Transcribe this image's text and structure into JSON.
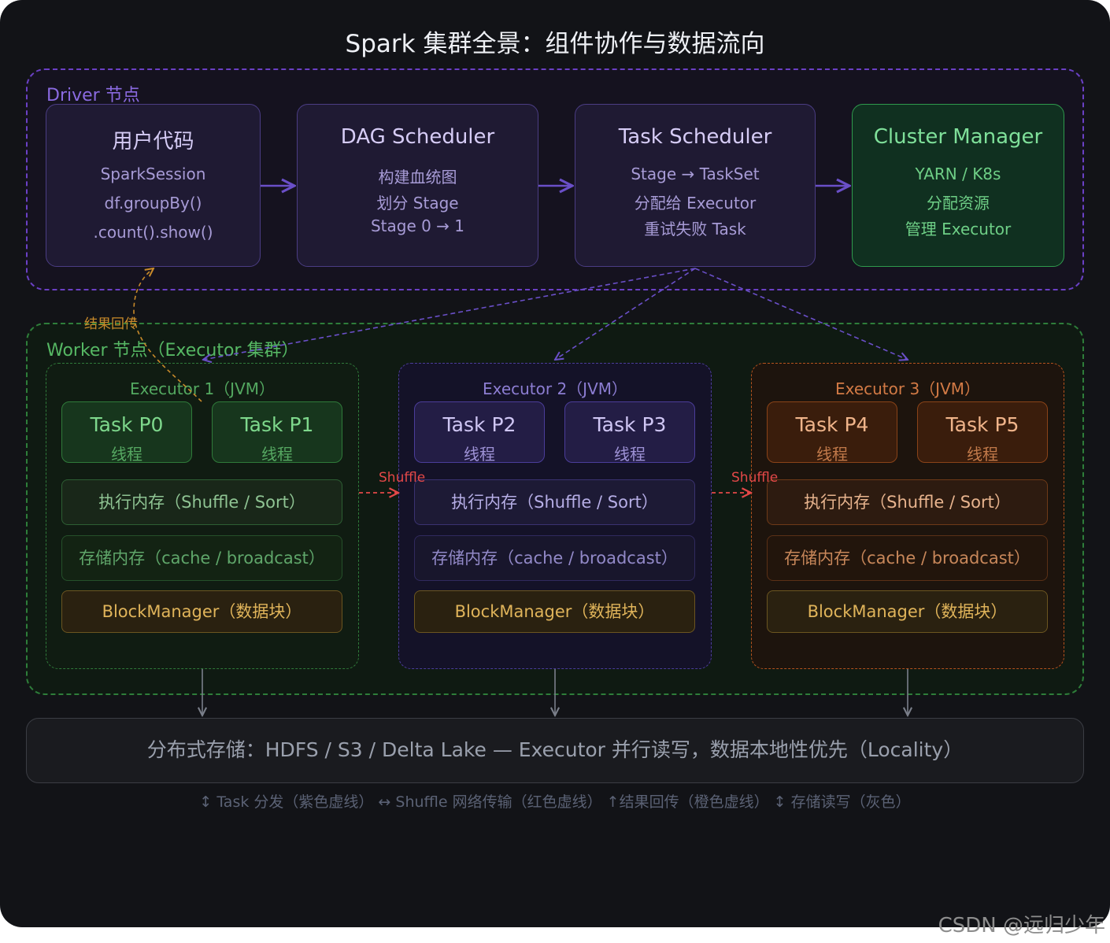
{
  "title": "Spark 集群全景：组件协作与数据流向",
  "driver": {
    "label": "Driver 节点",
    "user_code": {
      "title": "用户代码",
      "lines": [
        "SparkSession",
        "df.groupBy()",
        ".count().show()"
      ]
    },
    "dag_scheduler": {
      "title": "DAG Scheduler",
      "lines": [
        "构建血统图",
        "划分 Stage",
        "Stage 0 → 1"
      ]
    },
    "task_scheduler": {
      "title": "Task Scheduler",
      "lines": [
        "Stage → TaskSet",
        "分配给 Executor",
        "重试失败 Task"
      ]
    },
    "cluster_manager": {
      "title": "Cluster Manager",
      "lines": [
        "YARN / K8s",
        "分配资源",
        "管理 Executor"
      ]
    }
  },
  "result_label": "结果回传",
  "worker": {
    "label": "Worker 节点（Executor 集群）",
    "executors": [
      {
        "title": "Executor 1（JVM）",
        "tasks": [
          {
            "name": "Task P0",
            "sub": "线程"
          },
          {
            "name": "Task P1",
            "sub": "线程"
          }
        ],
        "exec_mem": "执行内存（Shuffle / Sort）",
        "storage_mem": "存储内存（cache / broadcast）",
        "block": "BlockManager（数据块）"
      },
      {
        "title": "Executor 2（JVM）",
        "tasks": [
          {
            "name": "Task P2",
            "sub": "线程"
          },
          {
            "name": "Task P3",
            "sub": "线程"
          }
        ],
        "exec_mem": "执行内存（Shuffle / Sort）",
        "storage_mem": "存储内存（cache / broadcast）",
        "block": "BlockManager（数据块）"
      },
      {
        "title": "Executor 3（JVM）",
        "tasks": [
          {
            "name": "Task P4",
            "sub": "线程"
          },
          {
            "name": "Task P5",
            "sub": "线程"
          }
        ],
        "exec_mem": "执行内存（Shuffle / Sort）",
        "storage_mem": "存储内存（cache / broadcast）",
        "block": "BlockManager（数据块）"
      }
    ],
    "shuffle_labels": [
      "Shuffle",
      "Shuffle"
    ]
  },
  "storage": "分布式存储：HDFS / S3 / Delta Lake — Executor 并行读写，数据本地性优先（Locality）",
  "legend": "↕ Task 分发（紫色虚线） ↔ Shuffle 网络传输（红色虚线） ↑结果回传（橙色虚线） ↕ 存储读写（灰色）",
  "watermark": "CSDN @远归少年",
  "colors": {
    "driver_accent": "#6a40c4",
    "worker_accent": "#2e7d3a",
    "executor2_accent": "#4b3d9a",
    "executor3_accent": "#b5531e",
    "shuffle_arrow": "#e34848",
    "result_arrow": "#c88a2a",
    "dispatch_arrow": "#6a4fc8",
    "storage_arrow": "#7a7f8a"
  }
}
